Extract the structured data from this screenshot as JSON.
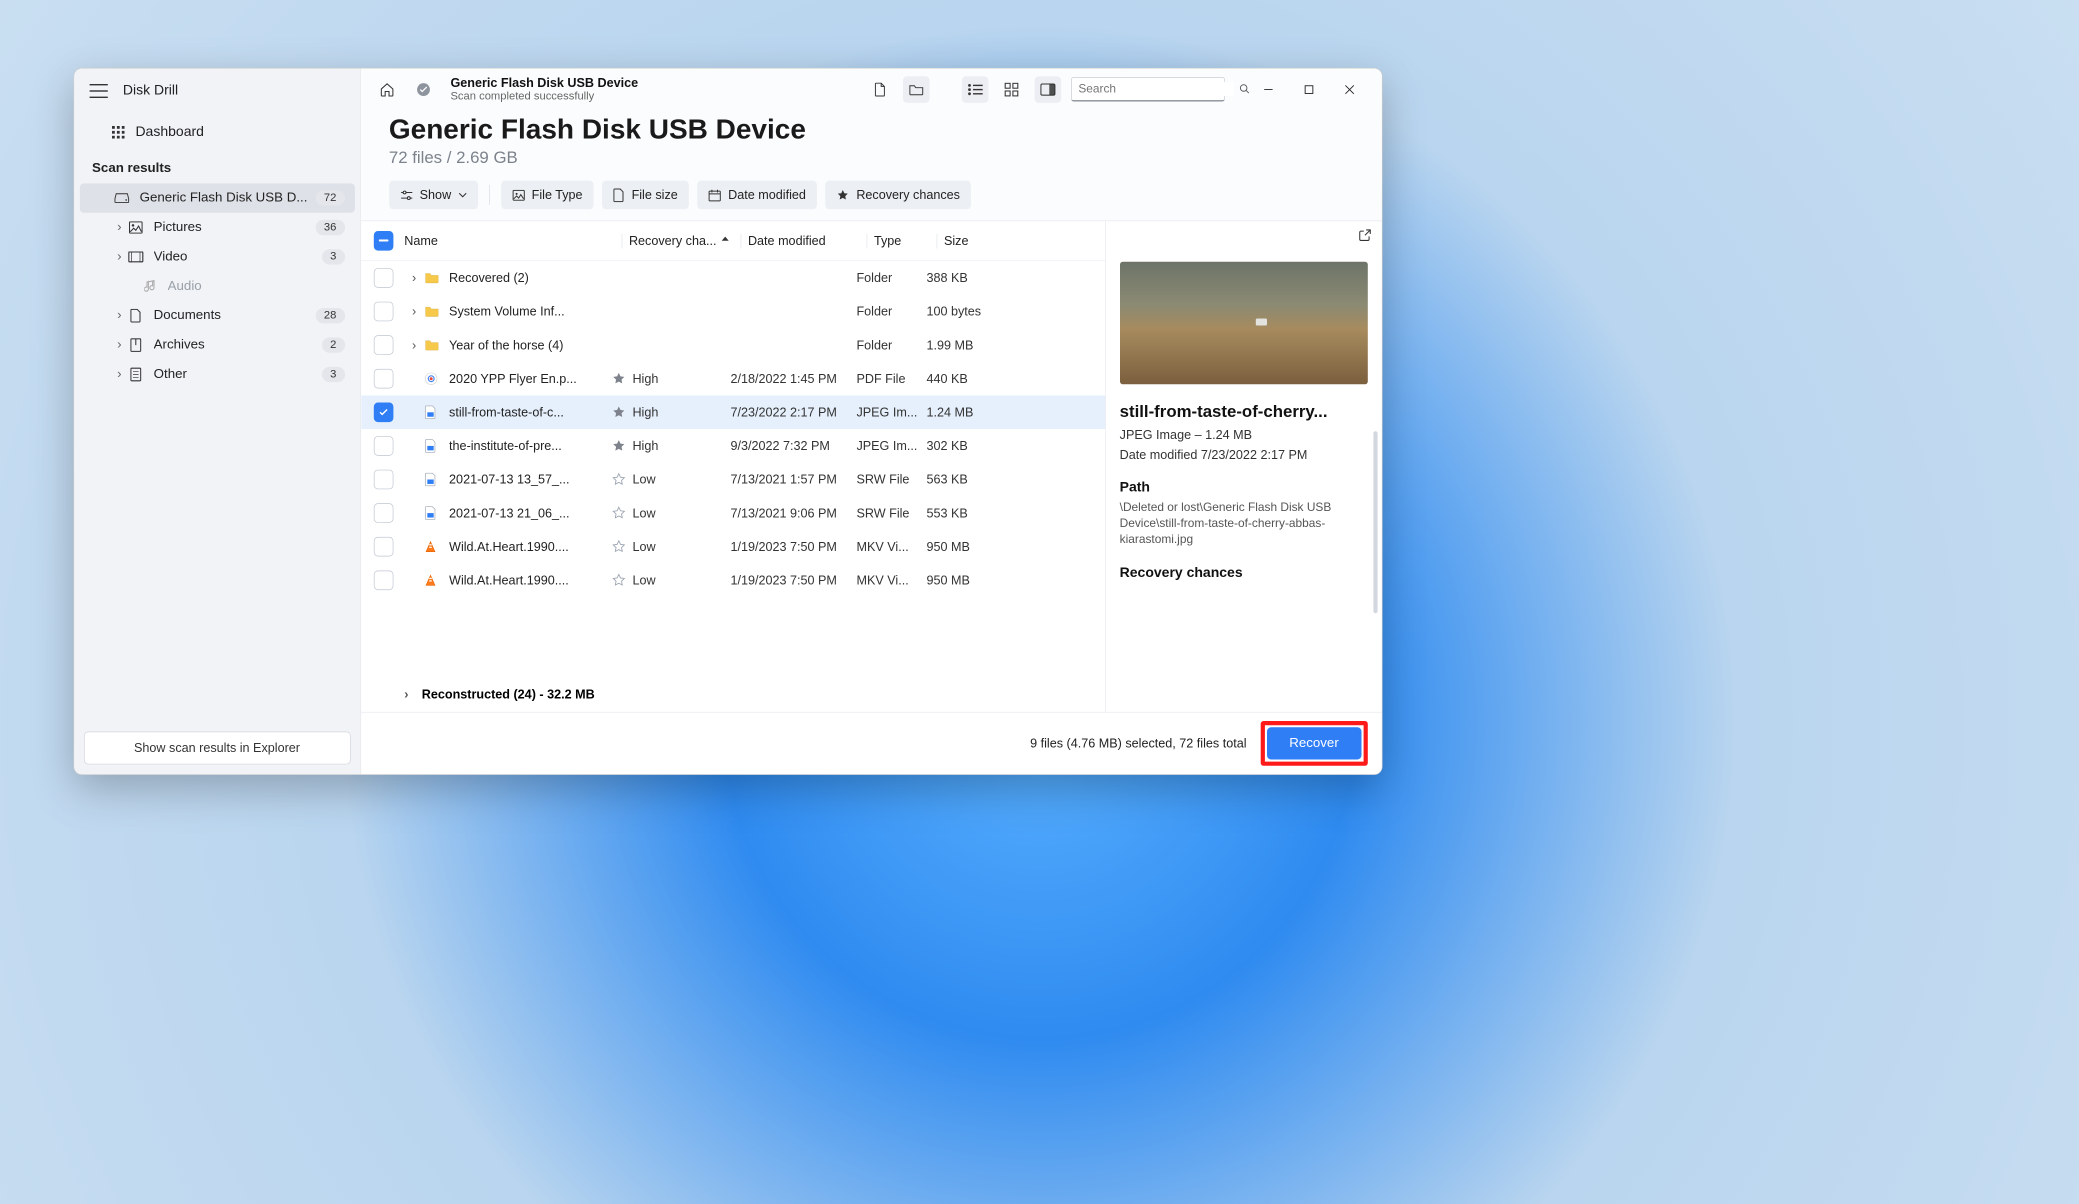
{
  "app": {
    "title": "Disk Drill"
  },
  "sidebar": {
    "dashboard": "Dashboard",
    "section": "Scan results",
    "device": {
      "label": "Generic Flash Disk USB D...",
      "count": "72"
    },
    "categories": [
      {
        "label": "Pictures",
        "count": "36"
      },
      {
        "label": "Video",
        "count": "3"
      },
      {
        "label": "Audio",
        "count": ""
      },
      {
        "label": "Documents",
        "count": "28"
      },
      {
        "label": "Archives",
        "count": "2"
      },
      {
        "label": "Other",
        "count": "3"
      }
    ],
    "explorer_btn": "Show scan results in Explorer"
  },
  "toolbar": {
    "title": "Generic Flash Disk USB Device",
    "subtitle": "Scan completed successfully",
    "search_placeholder": "Search"
  },
  "header": {
    "title": "Generic Flash Disk USB Device",
    "subtitle": "72 files / 2.69 GB"
  },
  "chips": {
    "show": "Show",
    "file_type": "File Type",
    "file_size": "File size",
    "date_modified": "Date modified",
    "recovery": "Recovery chances"
  },
  "columns": {
    "name": "Name",
    "recovery": "Recovery cha...",
    "date": "Date modified",
    "type": "Type",
    "size": "Size"
  },
  "rows": [
    {
      "kind": "folder",
      "name": "Recovered (2)",
      "recovery": "",
      "date": "",
      "type": "Folder",
      "size": "388 KB",
      "checked": false
    },
    {
      "kind": "folder",
      "name": "System Volume Inf...",
      "recovery": "",
      "date": "",
      "type": "Folder",
      "size": "100 bytes",
      "checked": false
    },
    {
      "kind": "folder",
      "name": "Year of the horse (4)",
      "recovery": "",
      "date": "",
      "type": "Folder",
      "size": "1.99 MB",
      "checked": false
    },
    {
      "kind": "pdf",
      "name": "2020 YPP Flyer En.p...",
      "recovery": "High",
      "date": "2/18/2022 1:45 PM",
      "type": "PDF File",
      "size": "440 KB",
      "star": true,
      "checked": false
    },
    {
      "kind": "jpeg",
      "name": "still-from-taste-of-c...",
      "recovery": "High",
      "date": "7/23/2022 2:17 PM",
      "type": "JPEG Im...",
      "size": "1.24 MB",
      "star": true,
      "checked": true,
      "selected": true
    },
    {
      "kind": "jpeg",
      "name": "the-institute-of-pre...",
      "recovery": "High",
      "date": "9/3/2022 7:32 PM",
      "type": "JPEG Im...",
      "size": "302 KB",
      "star": true,
      "checked": false
    },
    {
      "kind": "srw",
      "name": "2021-07-13 13_57_...",
      "recovery": "Low",
      "date": "7/13/2021 1:57 PM",
      "type": "SRW File",
      "size": "563 KB",
      "star": false,
      "checked": false
    },
    {
      "kind": "srw",
      "name": "2021-07-13 21_06_...",
      "recovery": "Low",
      "date": "7/13/2021 9:06 PM",
      "type": "SRW File",
      "size": "553 KB",
      "star": false,
      "checked": false
    },
    {
      "kind": "mkv",
      "name": "Wild.At.Heart.1990....",
      "recovery": "Low",
      "date": "1/19/2023 7:50 PM",
      "type": "MKV Vi...",
      "size": "950 MB",
      "star": false,
      "checked": false
    },
    {
      "kind": "mkv",
      "name": "Wild.At.Heart.1990....",
      "recovery": "Low",
      "date": "1/19/2023 7:50 PM",
      "type": "MKV Vi...",
      "size": "950 MB",
      "star": false,
      "checked": false
    }
  ],
  "reconstructed": "Reconstructed (24) - 32.2 MB",
  "preview": {
    "title": "still-from-taste-of-cherry...",
    "type_line": "JPEG Image – 1.24 MB",
    "date_line": "Date modified 7/23/2022 2:17 PM",
    "path_h": "Path",
    "path": "\\Deleted or lost\\Generic Flash Disk USB Device\\still-from-taste-of-cherry-abbas-kiarastomi.jpg",
    "recovery_h": "Recovery chances"
  },
  "footer": {
    "status": "9 files (4.76 MB) selected, 72 files total",
    "recover": "Recover"
  }
}
